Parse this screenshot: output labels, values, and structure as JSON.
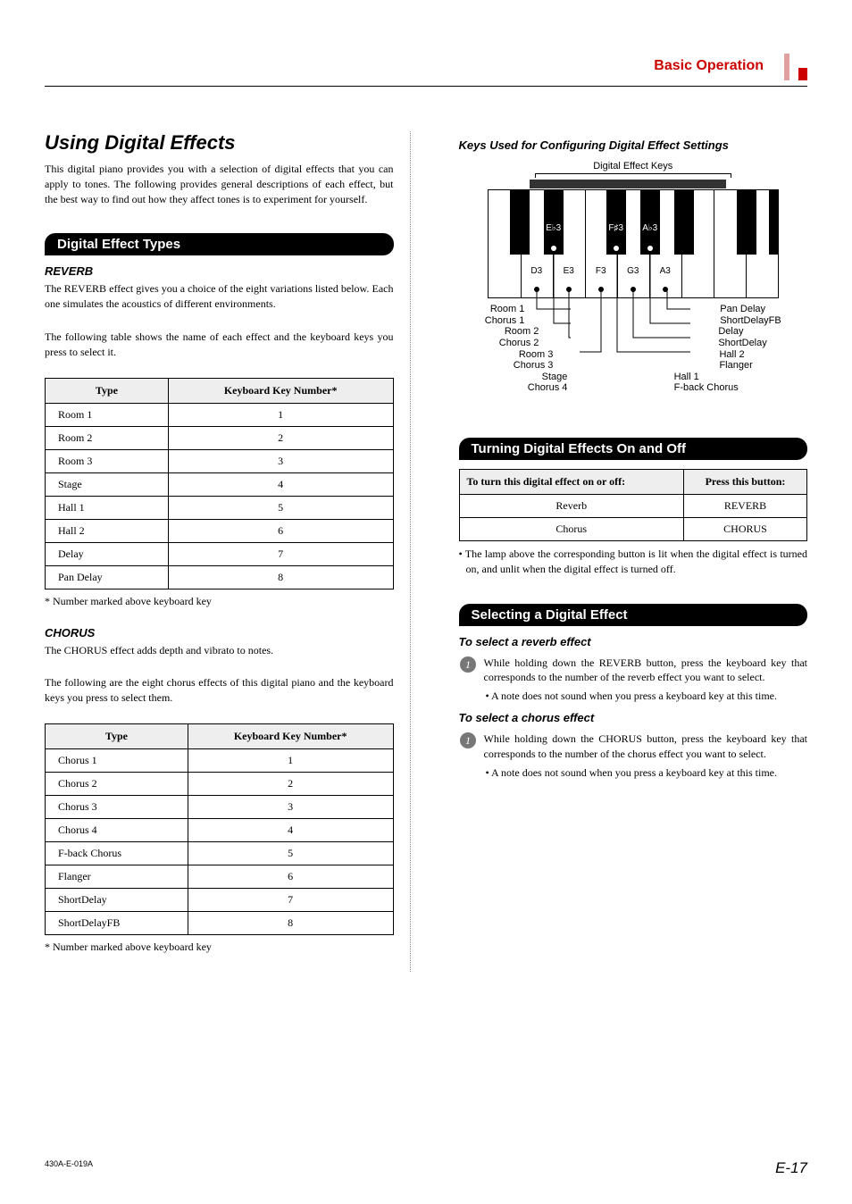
{
  "header": {
    "section": "Basic Operation"
  },
  "title": "Using Digital Effects",
  "intro": "This digital piano provides you with a selection of digital effects that you can apply to tones. The following provides general descriptions of each effect, but the best way to find out how they affect tones is to experiment for yourself.",
  "section_types": "Digital Effect Types",
  "reverb": {
    "heading": "REVERB",
    "desc1": "The REVERB effect gives you a choice of the eight variations listed below. Each one simulates the acoustics of different environments.",
    "desc2": "The following table shows the name of each effect and the keyboard keys you press to select it.",
    "table_headers": [
      "Type",
      "Keyboard Key Number*"
    ],
    "rows": [
      [
        "Room 1",
        "1"
      ],
      [
        "Room 2",
        "2"
      ],
      [
        "Room 3",
        "3"
      ],
      [
        "Stage",
        "4"
      ],
      [
        "Hall 1",
        "5"
      ],
      [
        "Hall 2",
        "6"
      ],
      [
        "Delay",
        "7"
      ],
      [
        "Pan Delay",
        "8"
      ]
    ],
    "footnote": "* Number marked above keyboard key"
  },
  "chorus": {
    "heading": "CHORUS",
    "desc1": "The CHORUS effect adds depth and vibrato to notes.",
    "desc2": "The following are the eight chorus effects of this digital piano and the keyboard keys you press to select them.",
    "table_headers": [
      "Type",
      "Keyboard Key Number*"
    ],
    "rows": [
      [
        "Chorus 1",
        "1"
      ],
      [
        "Chorus 2",
        "2"
      ],
      [
        "Chorus 3",
        "3"
      ],
      [
        "Chorus 4",
        "4"
      ],
      [
        "F-back Chorus",
        "5"
      ],
      [
        "Flanger",
        "6"
      ],
      [
        "ShortDelay",
        "7"
      ],
      [
        "ShortDelayFB",
        "8"
      ]
    ],
    "footnote": "* Number marked above keyboard key"
  },
  "keys_heading": "Keys Used for Configuring Digital Effect Settings",
  "kbd": {
    "top_label": "Digital Effect Keys",
    "black_labels": [
      "E♭3",
      "",
      "F♯3",
      "A♭3",
      ""
    ],
    "white_labels": [
      "",
      "D3",
      "E3",
      "F3",
      "G3",
      "A3",
      "",
      "",
      ""
    ],
    "ann_left": [
      [
        "Room 1",
        "Chorus 1"
      ],
      [
        "Room 2",
        "Chorus 2"
      ],
      [
        "Room 3",
        "Chorus 3"
      ],
      [
        "Stage",
        "Chorus 4"
      ]
    ],
    "ann_right": [
      [
        "Pan Delay",
        "ShortDelayFB"
      ],
      [
        "Delay",
        "ShortDelay"
      ],
      [
        "Hall 2",
        "Flanger"
      ],
      [
        "Hall 1",
        "F-back Chorus"
      ]
    ]
  },
  "turning": {
    "heading": "Turning Digital Effects On and Off",
    "table_headers": [
      "To turn this digital effect on or off:",
      "Press this button:"
    ],
    "rows": [
      [
        "Reverb",
        "REVERB"
      ],
      [
        "Chorus",
        "CHORUS"
      ]
    ],
    "note": "• The lamp above the corresponding button is lit when the digital effect is turned on, and unlit when the digital effect is turned off."
  },
  "selecting": {
    "heading": "Selecting a Digital Effect",
    "reverb_sub": "To select a reverb effect",
    "reverb_step": "While holding down the REVERB button, press the keyboard key that corresponds to the number of the reverb effect you want to select.",
    "reverb_note": "• A note does not sound when you press a keyboard key at this time.",
    "chorus_sub": "To select a chorus effect",
    "chorus_step": "While holding down the CHORUS button, press the keyboard key that corresponds to the number of the chorus effect you want to select.",
    "chorus_note": "• A note does not sound when you press a keyboard key at this time."
  },
  "footer": {
    "left": "430A-E-019A",
    "right": "E-17"
  }
}
